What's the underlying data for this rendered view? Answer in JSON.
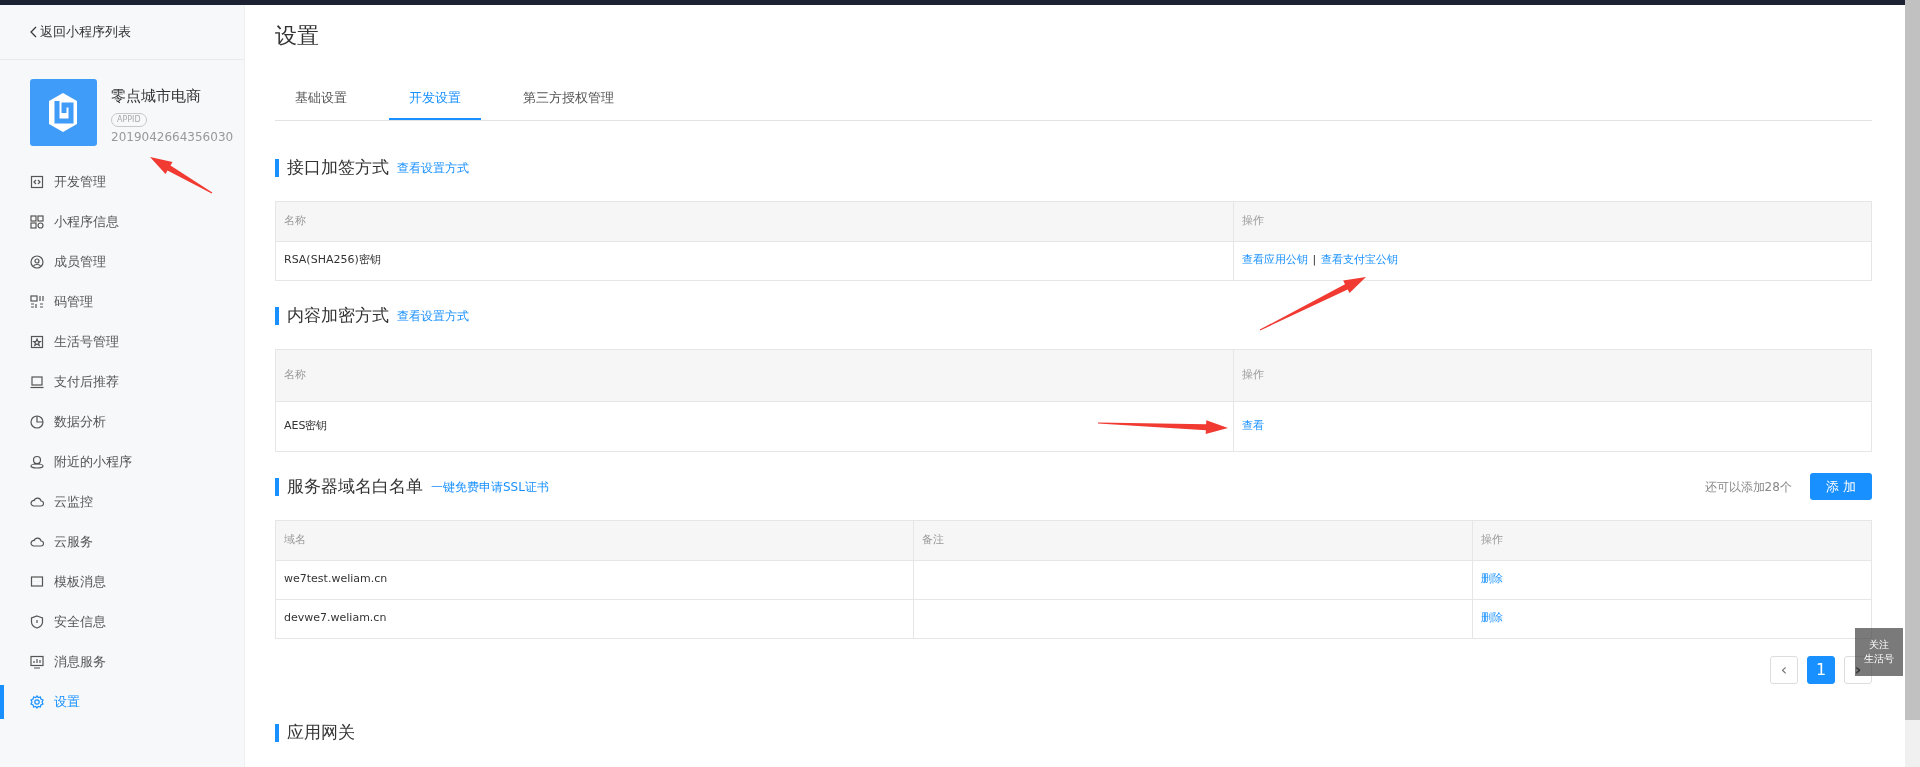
{
  "back_link": {
    "label": "返回小程序列表"
  },
  "app": {
    "name": "零点城市电商",
    "badge": "APPID",
    "id": "2019042664356030"
  },
  "sidebar": {
    "items": [
      {
        "label": "开发管理",
        "selected": false
      },
      {
        "label": "小程序信息",
        "selected": false
      },
      {
        "label": "成员管理",
        "selected": false
      },
      {
        "label": "码管理",
        "selected": false
      },
      {
        "label": "生活号管理",
        "selected": false
      },
      {
        "label": "支付后推荐",
        "selected": false
      },
      {
        "label": "数据分析",
        "selected": false
      },
      {
        "label": "附近的小程序",
        "selected": false
      },
      {
        "label": "云监控",
        "selected": false
      },
      {
        "label": "云服务",
        "selected": false
      },
      {
        "label": "模板消息",
        "selected": false
      },
      {
        "label": "安全信息",
        "selected": false
      },
      {
        "label": "消息服务",
        "selected": false
      },
      {
        "label": "设置",
        "selected": true
      }
    ]
  },
  "page_title": "设置",
  "tabs": [
    {
      "label": "基础设置",
      "selected": false
    },
    {
      "label": "开发设置",
      "selected": true
    },
    {
      "label": "第三方授权管理",
      "selected": false
    }
  ],
  "sections": [
    {
      "title": "接口加签方式",
      "link": "查看设置方式",
      "table": {
        "columns": [
          "名称",
          "操作"
        ],
        "rows": [
          {
            "cells": [
              {
                "kind": "text",
                "text": "RSA(SHA256)密钥"
              },
              {
                "kind": "links",
                "links": [
                  "查看应用公钥",
                  "查看支付宝公钥"
                ],
                "separator": "|"
              }
            ]
          }
        ]
      }
    },
    {
      "title": "内容加密方式",
      "link": "查看设置方式",
      "table": {
        "columns": [
          "名称",
          "操作"
        ],
        "rows": [
          {
            "cells": [
              {
                "kind": "text",
                "text": "AES密钥"
              },
              {
                "kind": "links",
                "links": [
                  "查看"
                ]
              }
            ]
          }
        ]
      }
    },
    {
      "title": "服务器域名白名单",
      "link": "一键免费申请SSL证书",
      "quota": "还可以添加28个",
      "add_button": "添 加",
      "table": {
        "columns": [
          "域名",
          "备注",
          "操作"
        ],
        "rows": [
          {
            "cells": [
              {
                "kind": "text",
                "text": "we7test.weliam.cn"
              },
              {
                "kind": "empty"
              },
              {
                "kind": "links",
                "links": [
                  "删除"
                ]
              }
            ]
          },
          {
            "cells": [
              {
                "kind": "text",
                "text": "devwe7.weliam.cn"
              },
              {
                "kind": "empty"
              },
              {
                "kind": "links",
                "links": [
                  "删除"
                ]
              }
            ]
          }
        ]
      },
      "pagination": {
        "prev": "‹",
        "pages": [
          {
            "label": "1",
            "selected": true
          }
        ],
        "next": "›"
      }
    },
    {
      "title": "应用网关"
    }
  ],
  "follow_widget": {
    "lines": [
      "关注",
      "生活号"
    ]
  },
  "annotations": [
    {
      "kind": "arrow"
    },
    {
      "kind": "arrow"
    },
    {
      "kind": "arrow"
    }
  ]
}
